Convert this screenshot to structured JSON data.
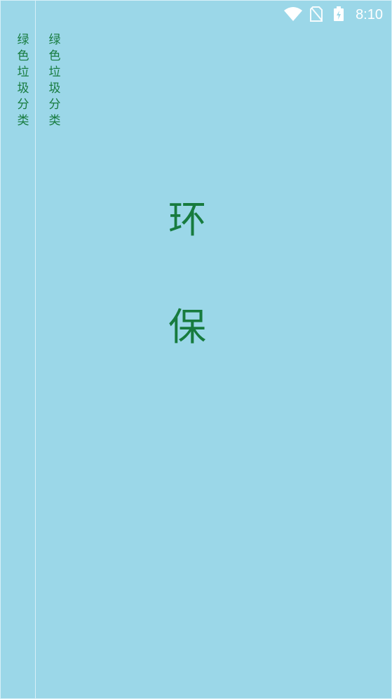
{
  "status_bar": {
    "time": "8:10",
    "icons": [
      "wifi-icon",
      "no-sim-icon",
      "battery-charging-icon"
    ]
  },
  "side_text": {
    "column_1": "绿色垃圾分类",
    "column_2": "绿色垃圾分类"
  },
  "main": {
    "char_1": "环",
    "char_2": "保"
  },
  "colors": {
    "background": "#9bd7e8",
    "text_green": "#177b3e",
    "divider": "#d7f0f8",
    "status_white": "#ffffff"
  }
}
